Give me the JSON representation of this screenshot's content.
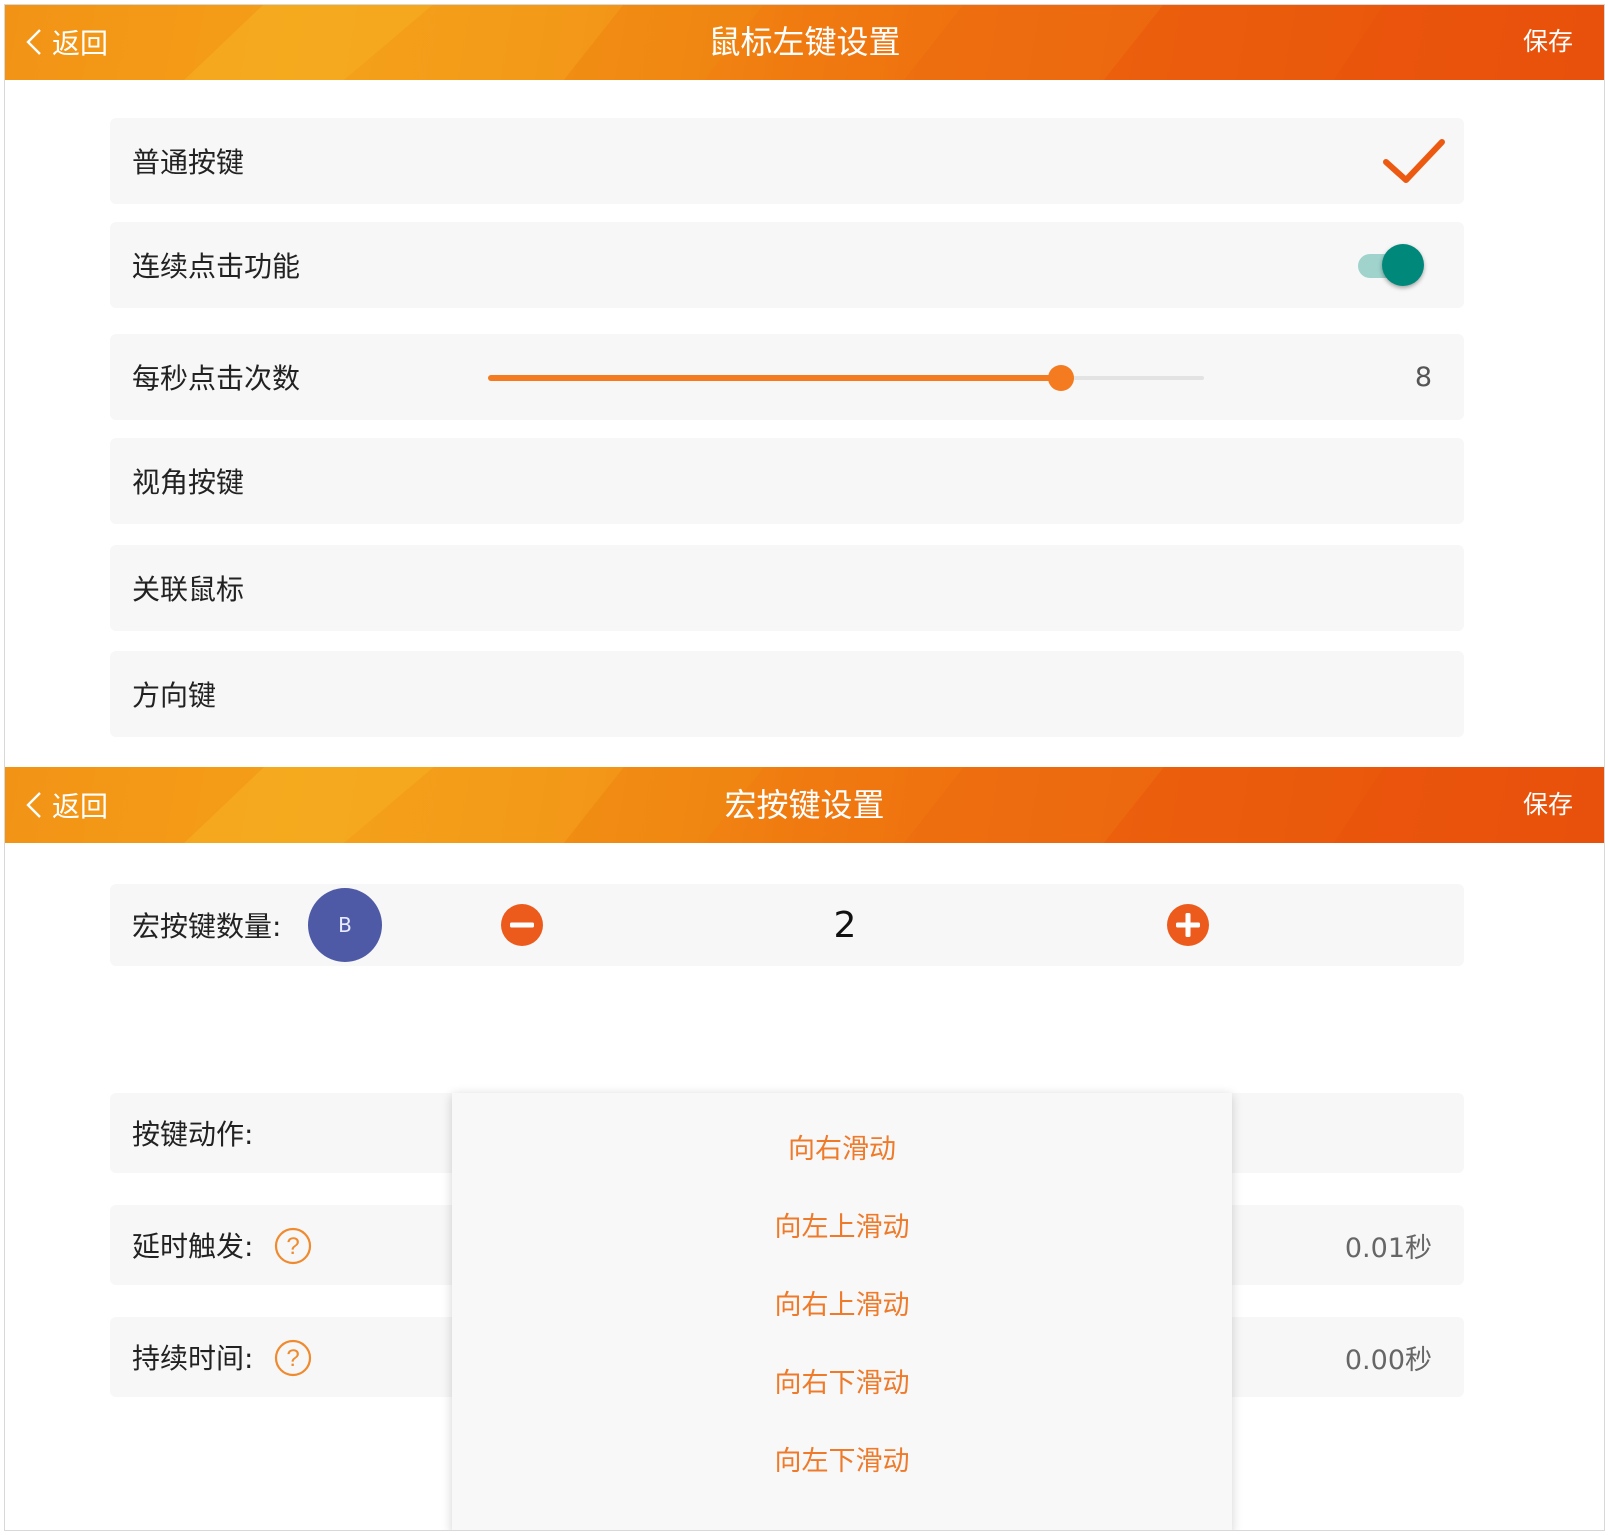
{
  "screen1": {
    "back_label": "返回",
    "title": "鼠标左键设置",
    "save_label": "保存",
    "rows": {
      "normal_key": "普通按键",
      "continuous_click": "连续点击功能",
      "clicks_per_second": "每秒点击次数",
      "view_key": "视角按键",
      "link_mouse": "关联鼠标",
      "direction_key": "方向键"
    },
    "continuous_click_enabled": true,
    "clicks_per_second_value": "8",
    "slider_fraction": 0.8
  },
  "screen2": {
    "back_label": "返回",
    "title": "宏按键设置",
    "save_label": "保存",
    "macro_count_label": "宏按键数量:",
    "avatar_letter": "B",
    "macro_count_value": "2",
    "action_label": "按键动作:",
    "delay_label": "延时触发:",
    "delay_value": "0.01秒",
    "duration_label": "持续时间:",
    "duration_value": "0.00秒",
    "dropdown_options": [
      "向右滑动",
      "向左上滑动",
      "向右上滑动",
      "向右下滑动",
      "向左下滑动"
    ]
  },
  "colors": {
    "accent": "#f47b20",
    "toggle": "#00897b",
    "avatar": "#4f5aa6",
    "dropdown_text": "#ee7a2a"
  },
  "icons": [
    "chevron-left-icon",
    "check-icon",
    "minus-circle-icon",
    "plus-circle-icon",
    "help-icon"
  ]
}
